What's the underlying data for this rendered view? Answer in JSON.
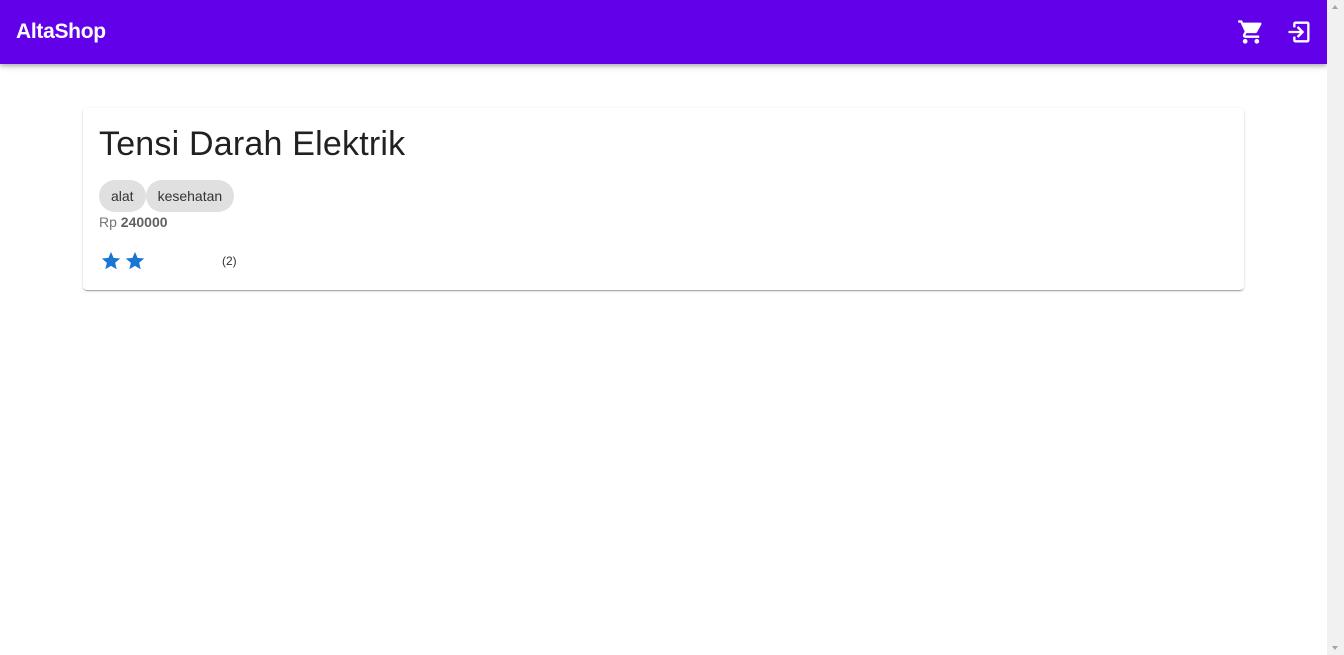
{
  "app": {
    "title": "AltaShop",
    "accent_color": "#6200ea"
  },
  "header": {
    "cart_icon": "cart-icon",
    "login_icon": "login-icon"
  },
  "product": {
    "name": "Tensi Darah Elektrik",
    "categories": [
      "alat",
      "kesehatan"
    ],
    "price_prefix": "Rp",
    "price_value": "240000",
    "rating": {
      "stars_filled": 2,
      "stars_total": 5,
      "count_label": "(2)",
      "star_color": "#1976d2"
    }
  }
}
